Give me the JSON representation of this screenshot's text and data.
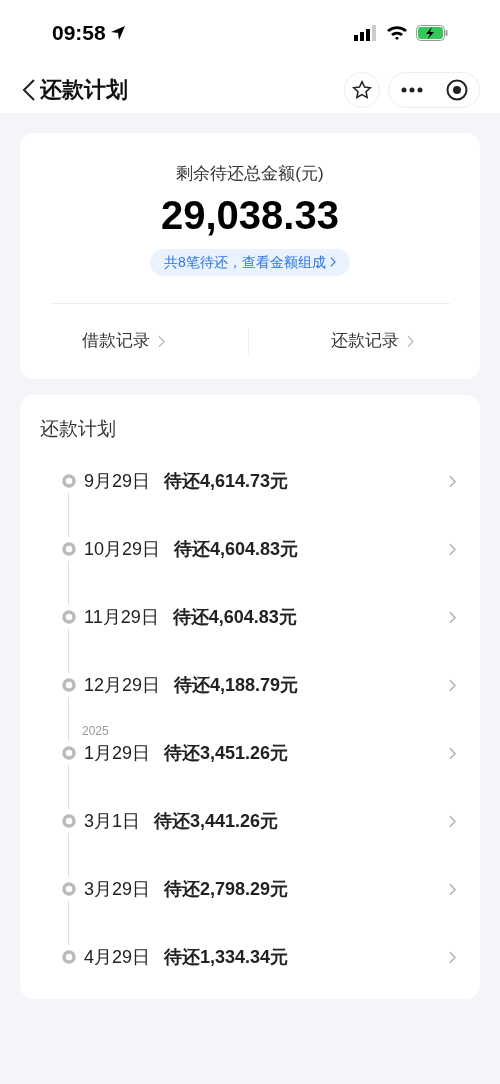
{
  "status_bar": {
    "time": "09:58"
  },
  "nav": {
    "title": "还款计划"
  },
  "summary": {
    "label": "剩余待还总金额(元)",
    "amount": "29,038.33",
    "detail_link": "共8笔待还，查看金额组成",
    "links": [
      "借款记录",
      "还款记录"
    ]
  },
  "plan": {
    "title": "还款计划",
    "items": [
      {
        "date": "9月29日",
        "amount": "待还4,614.73元"
      },
      {
        "date": "10月29日",
        "amount": "待还4,604.83元"
      },
      {
        "date": "11月29日",
        "amount": "待还4,604.83元"
      },
      {
        "date": "12月29日",
        "amount": "待还4,188.79元"
      },
      {
        "year": "2025",
        "date": "1月29日",
        "amount": "待还3,451.26元"
      },
      {
        "date": "3月1日",
        "amount": "待还3,441.26元"
      },
      {
        "date": "3月29日",
        "amount": "待还2,798.29元"
      },
      {
        "date": "4月29日",
        "amount": "待还1,334.34元"
      }
    ]
  }
}
